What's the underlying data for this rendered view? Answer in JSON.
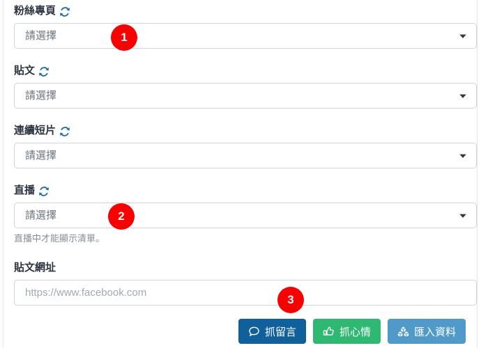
{
  "panel": {
    "accent_red": "#fa0000",
    "border_color": "#ced4da"
  },
  "fields": [
    {
      "label": "粉絲專頁",
      "refresh_icon": "sync-refresh-icon",
      "control": "select",
      "value": "請選擇",
      "chevron_icon": "chevron-down-icon"
    },
    {
      "label": "貼文",
      "refresh_icon": "sync-refresh-icon",
      "control": "select",
      "value": "請選擇",
      "chevron_icon": "chevron-down-icon"
    },
    {
      "label": "連續短片",
      "refresh_icon": "sync-refresh-icon",
      "control": "select",
      "value": "請選擇",
      "chevron_icon": "chevron-down-icon"
    },
    {
      "label": "直播",
      "refresh_icon": "sync-refresh-icon",
      "control": "select",
      "value": "請選擇",
      "chevron_icon": "chevron-down-icon",
      "helper": "直播中才能顯示清單。"
    },
    {
      "label": "貼文網址",
      "control": "text",
      "value": "",
      "placeholder": "https://www.facebook.com"
    }
  ],
  "buttons": [
    {
      "label": "抓留言",
      "icon": "comment-bubble-icon",
      "color": "#10619b"
    },
    {
      "label": "抓心情",
      "icon": "thumbs-up-icon",
      "color": "#2eb872"
    },
    {
      "label": "匯入資料",
      "icon": "cubes-icon",
      "color": "#4f9ac8"
    }
  ],
  "badges": [
    {
      "number": "1"
    },
    {
      "number": "2"
    },
    {
      "number": "3"
    }
  ]
}
